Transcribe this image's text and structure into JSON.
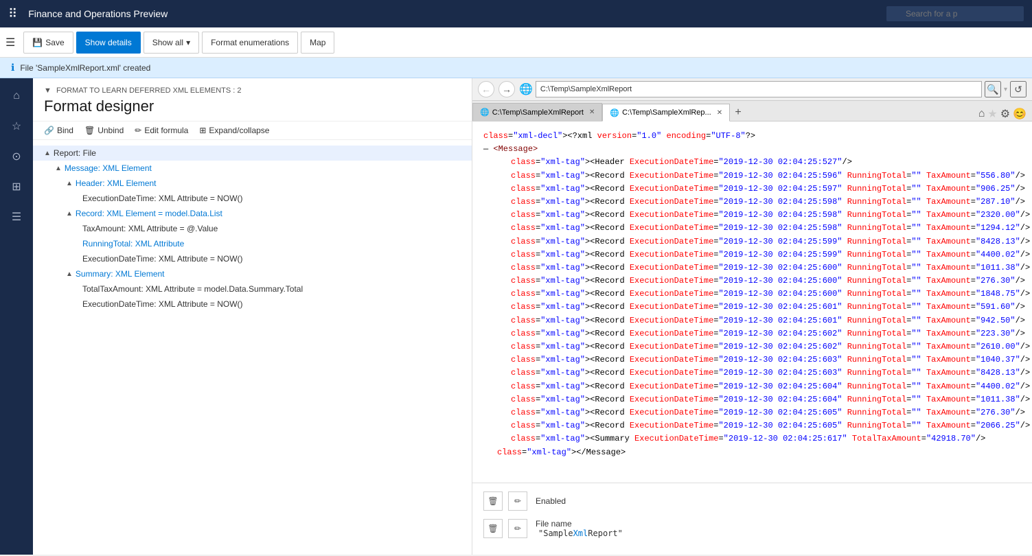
{
  "app": {
    "title": "Finance and Operations Preview",
    "search_placeholder": "Search for a p"
  },
  "toolbar": {
    "save_label": "Save",
    "show_details_label": "Show details",
    "show_all_label": "Show all",
    "format_enum_label": "Format enumerations",
    "map_label": "Map"
  },
  "notification": {
    "message": "File 'SampleXmlReport.xml' created"
  },
  "designer": {
    "format_label": "FORMAT TO LEARN DEFERRED XML ELEMENTS : 2",
    "title": "Format designer",
    "sub_toolbar": {
      "bind_label": "Bind",
      "unbind_label": "Unbind",
      "edit_formula_label": "Edit formula",
      "expand_collapse_label": "Expand/collapse"
    },
    "tree": [
      {
        "level": 0,
        "indent": 0,
        "arrow": "▲",
        "text": "Report: File",
        "selected": true
      },
      {
        "level": 1,
        "indent": 1,
        "arrow": "▲",
        "text": "Message: XML Element",
        "blue": true
      },
      {
        "level": 2,
        "indent": 2,
        "arrow": "▲",
        "text": "Header: XML Element",
        "blue": true
      },
      {
        "level": 3,
        "indent": 3,
        "arrow": "",
        "text": "ExecutionDateTime: XML Attribute = NOW()",
        "blue": false
      },
      {
        "level": 2,
        "indent": 2,
        "arrow": "▲",
        "text": "Record: XML Element = model.Data.List",
        "blue": true
      },
      {
        "level": 3,
        "indent": 3,
        "arrow": "",
        "text": "TaxAmount: XML Attribute = @.Value",
        "blue": false
      },
      {
        "level": 3,
        "indent": 3,
        "arrow": "",
        "text": "RunningTotal: XML Attribute",
        "blue": true
      },
      {
        "level": 3,
        "indent": 3,
        "arrow": "",
        "text": "ExecutionDateTime: XML Attribute = NOW()",
        "blue": false
      },
      {
        "level": 2,
        "indent": 2,
        "arrow": "▲",
        "text": "Summary: XML Element",
        "blue": true
      },
      {
        "level": 3,
        "indent": 3,
        "arrow": "",
        "text": "TotalTaxAmount: XML Attribute = model.Data.Summary.Total",
        "blue": false
      },
      {
        "level": 3,
        "indent": 3,
        "arrow": "",
        "text": "ExecutionDateTime: XML Attribute = NOW()",
        "blue": false
      }
    ]
  },
  "browser": {
    "url1": "C:\\Temp\\SampleXmlReport",
    "url2": "C:\\Temp\\SampleXmlRep...",
    "tabs": [
      {
        "label": "C:\\Temp\\SampleXmlReport",
        "active": false
      },
      {
        "label": "C:\\Temp\\SampleXmlRep...",
        "active": true
      }
    ],
    "xml": {
      "declaration": "<?xml version=\"1.0\" encoding=\"UTF-8\"?>",
      "message_open": "<Message>",
      "header": "<Header ExecutionDateTime=\"2019-12-30 02:04:25:527\"/>",
      "records": [
        "<Record ExecutionDateTime=\"2019-12-30 02:04:25:596\" RunningTotal=\"\" TaxAmount=\"556.80\"/>",
        "<Record ExecutionDateTime=\"2019-12-30 02:04:25:597\" RunningTotal=\"\" TaxAmount=\"906.25\"/>",
        "<Record ExecutionDateTime=\"2019-12-30 02:04:25:598\" RunningTotal=\"\" TaxAmount=\"287.10\"/>",
        "<Record ExecutionDateTime=\"2019-12-30 02:04:25:598\" RunningTotal=\"\" TaxAmount=\"2320.00\"/>",
        "<Record ExecutionDateTime=\"2019-12-30 02:04:25:598\" RunningTotal=\"\" TaxAmount=\"1294.12\"/>",
        "<Record ExecutionDateTime=\"2019-12-30 02:04:25:599\" RunningTotal=\"\" TaxAmount=\"8428.13\"/>",
        "<Record ExecutionDateTime=\"2019-12-30 02:04:25:599\" RunningTotal=\"\" TaxAmount=\"4400.02\"/>",
        "<Record ExecutionDateTime=\"2019-12-30 02:04:25:600\" RunningTotal=\"\" TaxAmount=\"1011.38\"/>",
        "<Record ExecutionDateTime=\"2019-12-30 02:04:25:600\" RunningTotal=\"\" TaxAmount=\"276.30\"/>",
        "<Record ExecutionDateTime=\"2019-12-30 02:04:25:600\" RunningTotal=\"\" TaxAmount=\"1848.75\"/>",
        "<Record ExecutionDateTime=\"2019-12-30 02:04:25:601\" RunningTotal=\"\" TaxAmount=\"591.60\"/>",
        "<Record ExecutionDateTime=\"2019-12-30 02:04:25:601\" RunningTotal=\"\" TaxAmount=\"942.50\"/>",
        "<Record ExecutionDateTime=\"2019-12-30 02:04:25:602\" RunningTotal=\"\" TaxAmount=\"223.30\"/>",
        "<Record ExecutionDateTime=\"2019-12-30 02:04:25:602\" RunningTotal=\"\" TaxAmount=\"2610.00\"/>",
        "<Record ExecutionDateTime=\"2019-12-30 02:04:25:603\" RunningTotal=\"\" TaxAmount=\"1040.37\"/>",
        "<Record ExecutionDateTime=\"2019-12-30 02:04:25:603\" RunningTotal=\"\" TaxAmount=\"8428.13\"/>",
        "<Record ExecutionDateTime=\"2019-12-30 02:04:25:604\" RunningTotal=\"\" TaxAmount=\"4400.02\"/>",
        "<Record ExecutionDateTime=\"2019-12-30 02:04:25:604\" RunningTotal=\"\" TaxAmount=\"1011.38\"/>",
        "<Record ExecutionDateTime=\"2019-12-30 02:04:25:605\" RunningTotal=\"\" TaxAmount=\"276.30\"/>",
        "<Record ExecutionDateTime=\"2019-12-30 02:04:25:605\" RunningTotal=\"\" TaxAmount=\"2066.25\"/>"
      ],
      "summary": "<Summary ExecutionDateTime=\"2019-12-30 02:04:25:617\" TotalTaxAmount=\"42918.70\"/>",
      "message_close": "</Message>"
    }
  },
  "properties": [
    {
      "label": "Enabled"
    },
    {
      "label": "File name",
      "value": "\"SampleXmlReport\"",
      "value_highlight": "Xml"
    }
  ],
  "sidebar_icons": [
    "≡",
    "⌂",
    "★",
    "🕐",
    "▦",
    "☰"
  ]
}
